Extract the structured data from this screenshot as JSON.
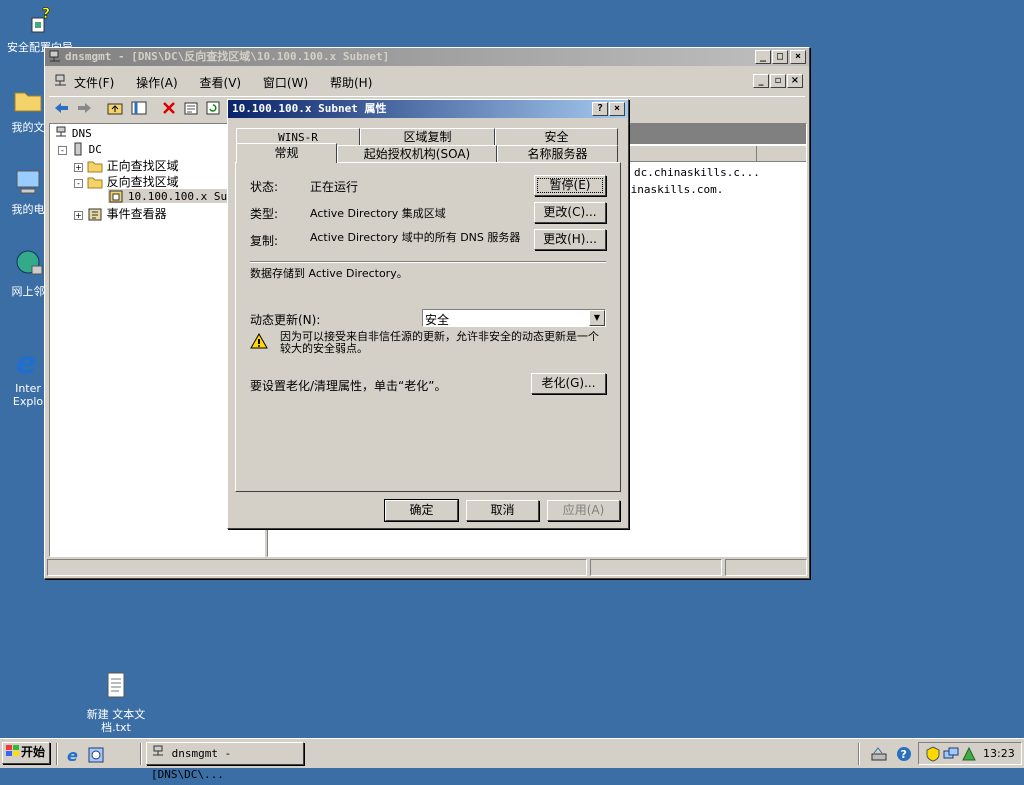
{
  "desktop": {
    "icons": [
      {
        "label": "安全配置向导"
      },
      {
        "label": "我的文"
      },
      {
        "label": "我的电"
      },
      {
        "label": "网上邻"
      },
      {
        "label": "Inter\nExplo"
      },
      {
        "label": "新建 文本文\n档.txt"
      }
    ]
  },
  "mmc": {
    "title": "dnsmgmt - [DNS\\DC\\反向查找区域\\10.100.100.x Subnet]",
    "menu": [
      "文件(F)",
      "操作(A)",
      "查看(V)",
      "窗口(W)",
      "帮助(H)"
    ],
    "tree": {
      "root": "DNS",
      "server": "DC",
      "forward": "正向查找区域",
      "reverse": "反向查找区域",
      "zone": "10.100.100.x Sub",
      "events": "事件查看器"
    },
    "right_items": [
      "dc.chinaskills.c...",
      "hinaskills.com."
    ]
  },
  "dialog": {
    "title": "10.100.100.x Subnet 属性",
    "tabs_back": [
      "WINS-R",
      "区域复制",
      "安全"
    ],
    "tabs_front": [
      "常规",
      "起始授权机构(SOA)",
      "名称服务器"
    ],
    "status_label": "状态:",
    "status_value": "正在运行",
    "pause_btn": "暂停(E)",
    "type_label": "类型:",
    "type_value": "Active Directory 集成区域",
    "change_type_btn": "更改(C)...",
    "repl_label": "复制:",
    "repl_value": "Active Directory 域中的所有 DNS 服务器",
    "change_repl_btn": "更改(H)...",
    "stored": "数据存储到 Active Directory。",
    "dyn_label": "动态更新(N):",
    "dyn_value": "安全",
    "warning": "因为可以接受来自非信任源的更新，允许非安全的动态更新是一个较大的安全弱点。",
    "aging_text": "要设置老化/清理属性，单击“老化”。",
    "aging_btn": "老化(G)...",
    "ok": "确定",
    "cancel": "取消",
    "apply": "应用(A)"
  },
  "taskbar": {
    "start": "开始",
    "task": "dnsmgmt - [DNS\\DC\\...",
    "clock": "13:23"
  }
}
